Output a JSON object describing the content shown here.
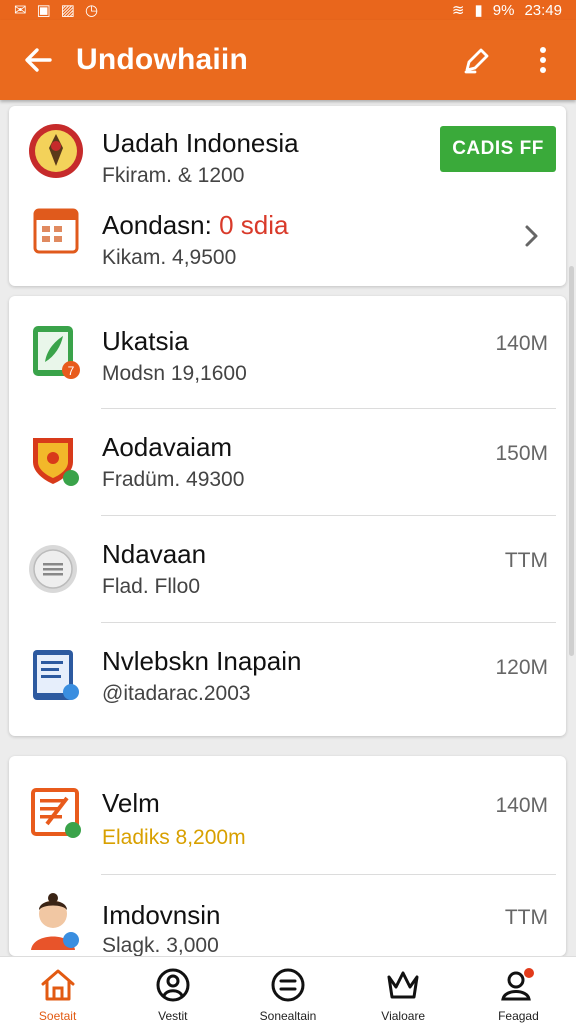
{
  "status": {
    "time": "23:49",
    "battery": "9%"
  },
  "header": {
    "title": "Undowhaiin"
  },
  "card1": {
    "item1": {
      "name": "Uadah Indonesia",
      "sub": "Fkiram. & 1200",
      "button": "CADIS FF"
    },
    "item2": {
      "name_prefix": "Aondasn:",
      "name_accent": "0 sdia",
      "sub": "Kikam. 4,9500"
    }
  },
  "card2": {
    "items": [
      {
        "name": "Ukatsia",
        "sub": "Modsn 19,1600",
        "size": "140M"
      },
      {
        "name": "Aodavaiam",
        "sub": "Fradüm. 49300",
        "size": "150M"
      },
      {
        "name": "Ndavaan",
        "sub": "Flad. Fllo0",
        "size": "TTM"
      },
      {
        "name": "Nvlebskn Inapain",
        "sub": "@itadarac.2003",
        "size": "120M"
      }
    ]
  },
  "card3": {
    "items": [
      {
        "name": "Velm",
        "sub": "Eladiks 8,200m",
        "size": "140M"
      },
      {
        "name": "Imdovnsin",
        "sub": "Slagk. 3,000",
        "size": "TTM"
      }
    ]
  },
  "nav": [
    {
      "label": "Soetait",
      "icon": "home-icon",
      "active": true
    },
    {
      "label": "Vestit",
      "icon": "profile-circle-icon"
    },
    {
      "label": "Sonealtain",
      "icon": "menu-circle-icon"
    },
    {
      "label": "Vialoare",
      "icon": "crown-icon"
    },
    {
      "label": "Feagad",
      "icon": "person-notification-icon"
    }
  ],
  "colors": {
    "primary": "#ea6a1e",
    "green": "#3aaa3a",
    "accent_red": "#d93a2a",
    "accent_yellow": "#d8a000"
  }
}
